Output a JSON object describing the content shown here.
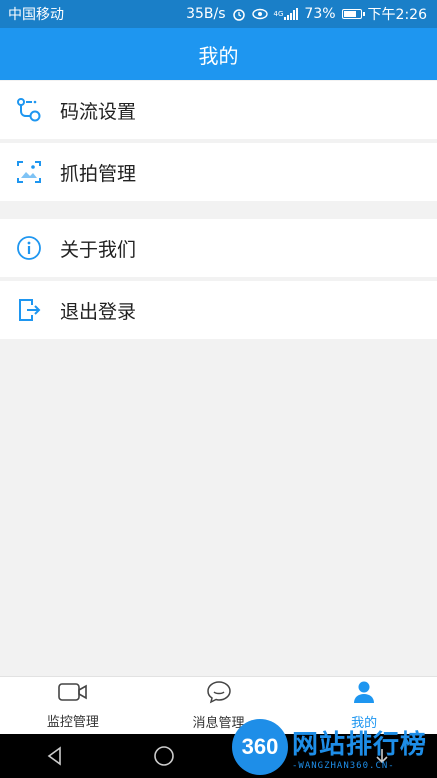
{
  "status_bar": {
    "carrier": "中国移动",
    "speed": "35B/s",
    "battery": "73%",
    "time": "下午2:26",
    "network_tag": "4G"
  },
  "header": {
    "title": "我的"
  },
  "menu": {
    "group1": [
      {
        "label": "码流设置",
        "icon": "stream-settings-icon"
      },
      {
        "label": "抓拍管理",
        "icon": "snapshot-icon"
      }
    ],
    "group2": [
      {
        "label": "关于我们",
        "icon": "info-icon"
      },
      {
        "label": "退出登录",
        "icon": "logout-icon"
      }
    ]
  },
  "bottom_nav": {
    "items": [
      {
        "label": "监控管理",
        "icon": "video-camera-icon",
        "active": false
      },
      {
        "label": "消息管理",
        "icon": "chat-bubble-icon",
        "active": false
      },
      {
        "label": "我的",
        "icon": "user-icon",
        "active": true
      }
    ]
  },
  "watermark": {
    "badge": "360",
    "title": "网站排行榜",
    "subtitle": "-WANGZHAN360.CN-"
  },
  "colors": {
    "accent": "#1e96f0",
    "status_bar": "#1a7fc8",
    "background": "#f2f2f2"
  }
}
